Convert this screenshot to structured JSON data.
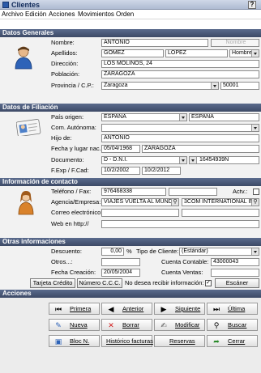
{
  "window": {
    "title": "Clientes",
    "help": "?"
  },
  "menu": [
    "Archivo",
    "Edición",
    "Acciones",
    "Movimientos",
    "Orden"
  ],
  "sections": {
    "general": "Datos Generales",
    "filiacion": "Datos de Filiación",
    "contacto": "Información de contacto",
    "otras": "Otras informaciones",
    "acciones": "Acciones"
  },
  "general": {
    "nombre_label": "Nombre:",
    "nombre": "ANTONIO",
    "nombre_btn": "Nombre",
    "apellidos_label": "Apellidos:",
    "apellido1": "GOMEZ",
    "apellido2": "LOPEZ",
    "sexo": "Hombre",
    "direccion_label": "Dirección:",
    "direccion": "LOS MOLINOS, 24",
    "poblacion_label": "Población:",
    "poblacion": "ZARAGOZA",
    "provincia_label": "Provincia / C.P.:",
    "provincia": "Zaragoza",
    "cp": "50001"
  },
  "filiacion": {
    "pais_label": "País origen:",
    "pais": "ESPAÑA",
    "pais2": "ESPAÑA",
    "com_label": "Com. Autónoma:",
    "com": "",
    "hijo_label": "Hijo de:",
    "hijo": "ANTONIO",
    "fecha_label": "Fecha y lugar nac.:",
    "fecha": "05/04/1968",
    "lugar": "ZARAGOZA",
    "doc_label": "Documento:",
    "doc_tipo": "D - D.N.I.",
    "doc_num": "16454939N",
    "fexp_label": "F.Exp / F.Cad:",
    "fexp": "10/2/2002",
    "fcad": "10/2/2012"
  },
  "contacto": {
    "tel_label": "Teléfono / Fax:",
    "tel": "976468338",
    "fax": "",
    "actv_label": "Actv.:",
    "agencia_label": "Agencia/Empresa:",
    "agencia": "VIAJES VUELTA AL MUNDO",
    "empresa": "3COM INTERNATIONAL IN",
    "correo_label": "Correo electrónico:",
    "correo": "",
    "web_label": "Web en http://",
    "web": ""
  },
  "otras": {
    "descuento_label": "Descuento:",
    "descuento": "0,00",
    "pct": "%",
    "tipo_label": "Tipo de Cliente:",
    "tipo": "(Estándar)",
    "otros_label": "Otros...:",
    "otros": "",
    "cuenta_contable_label": "Cuenta Contable:",
    "cuenta_contable": "43000043",
    "fecha_creacion_label": "Fecha Creación:",
    "fecha_creacion": "20/05/2004",
    "cuenta_ventas_label": "Cuenta Ventas:",
    "cuenta_ventas": "",
    "tarjeta_btn": "Tarjeta Crédito",
    "ccc_btn": "Número C.C.C.",
    "no_info_label": "No desea recibir información:",
    "escaner_btn": "Escáner"
  },
  "acciones": {
    "primera": "Primera",
    "anterior": "Anterior",
    "siguiente": "Siguiente",
    "ultima": "Última",
    "nueva": "Nueva",
    "borrar": "Borrar",
    "modificar": "Modificar",
    "buscar": "Buscar",
    "bloc": "Bloc N.",
    "historico": "Histórico facturas",
    "reservas": "Reservas",
    "cerrar": "Cerrar"
  }
}
